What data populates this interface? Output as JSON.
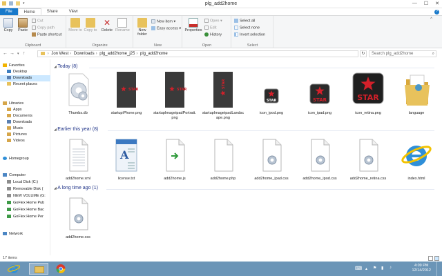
{
  "window": {
    "title": "plg_add2home",
    "controls": [
      "—",
      "☐",
      "✕"
    ]
  },
  "tabs": [
    "File",
    "Home",
    "Share",
    "View"
  ],
  "ribbon": {
    "clipboard": {
      "label": "Clipboard",
      "copy": "Copy",
      "paste": "Paste",
      "cut": "Cut",
      "copy_path": "Copy path",
      "paste_shortcut": "Paste shortcut"
    },
    "organize": {
      "label": "Organize",
      "move_to": "Move to",
      "copy_to": "Copy to",
      "delete": "Delete",
      "rename": "Rename"
    },
    "new": {
      "label": "New",
      "new_folder": "New folder",
      "new_item": "New item ▾",
      "easy_access": "Easy access ▾"
    },
    "open": {
      "label": "Open",
      "properties": "Properties",
      "open": "Open ▾",
      "edit": "Edit",
      "history": "History"
    },
    "select": {
      "label": "Select",
      "select_all": "Select all",
      "select_none": "Select none",
      "invert": "Invert selection"
    }
  },
  "address": {
    "crumbs": [
      "Jon West",
      "Downloads",
      "plg_add2home_j25",
      "plg_add2home"
    ],
    "search_placeholder": "Search plg_add2home"
  },
  "nav": {
    "favorites": "Favorites",
    "desktop": "Desktop",
    "downloads": "Downloads",
    "recent": "Recent places",
    "libraries": "Libraries",
    "apps": "Apps",
    "documents": "Documents",
    "downloads_lib": "Downloads",
    "music": "Music",
    "pictures": "Pictures",
    "videos": "Videos",
    "homegroup": "Homegroup",
    "computer": "Computer",
    "local_disk": "Local Disk (C:)",
    "removable": "Removable Disk (",
    "new_volume": "NEW VOLUME (G:",
    "goflex1": "GoFlex Home Pub",
    "goflex2": "GoFlex Home Bac",
    "goflex3": "GoFlex Home Per",
    "network": "Network"
  },
  "groups": {
    "today": "Today (8)",
    "earlier": "Earlier this year (8)",
    "long_ago": "A long time ago (1)"
  },
  "files_today": [
    {
      "name": "Thumbs.db",
      "kind": "gear"
    },
    {
      "name": "startupiPhone.png",
      "kind": "star-dark"
    },
    {
      "name": "startupImageipadPortrait.png",
      "kind": "star-dark"
    },
    {
      "name": "startupImageipadLandscape.png",
      "kind": "star-dark-rot"
    },
    {
      "name": "icon_ipod.png",
      "kind": "star-icon-sm"
    },
    {
      "name": "icon_ipad.png",
      "kind": "star-icon-md"
    },
    {
      "name": "icon_retina.png",
      "kind": "star-icon-lg"
    },
    {
      "name": "language",
      "kind": "folder"
    }
  ],
  "files_earlier": [
    {
      "name": "add2home.xml",
      "kind": "doc"
    },
    {
      "name": "license.txt",
      "kind": "txt"
    },
    {
      "name": "add2home.js",
      "kind": "js"
    },
    {
      "name": "add2home.php",
      "kind": "blank"
    },
    {
      "name": "add2home_ipad.css",
      "kind": "css"
    },
    {
      "name": "add2home_ipod.css",
      "kind": "css"
    },
    {
      "name": "add2home_retina.css",
      "kind": "css"
    },
    {
      "name": "index.html",
      "kind": "ie"
    }
  ],
  "files_old": [
    {
      "name": "add2home.css",
      "kind": "css"
    }
  ],
  "status": {
    "items": "17 items"
  },
  "clock": {
    "time": "4:09 PM",
    "date": "12/14/2012"
  },
  "star_text": "STAR",
  "colors": {
    "accent": "#1979ca",
    "group_head": "#1e3287",
    "taskbar": "#6b95b7",
    "star_red": "#d3202a",
    "folder": "#e8c25c"
  }
}
